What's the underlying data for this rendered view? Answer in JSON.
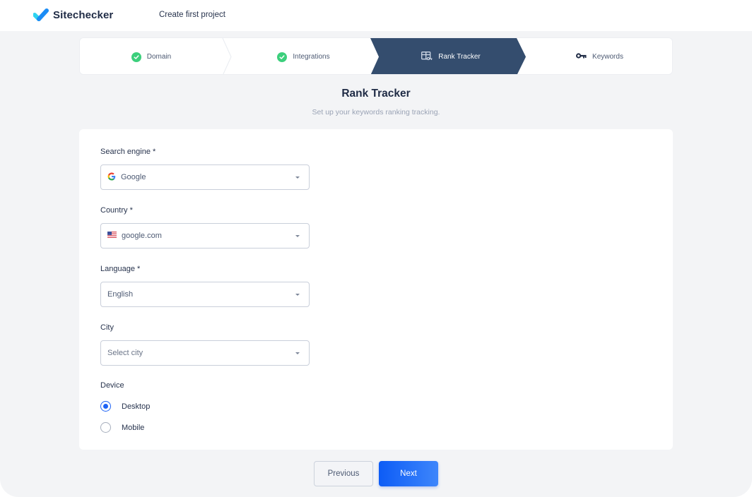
{
  "header": {
    "brand": "Sitechecker",
    "page_heading": "Create first project"
  },
  "stepper": {
    "steps": [
      {
        "label": "Domain",
        "state": "completed",
        "icon": "check-circle-icon"
      },
      {
        "label": "Integrations",
        "state": "completed",
        "icon": "check-circle-icon"
      },
      {
        "label": "Rank Tracker",
        "state": "active",
        "icon": "rank-tracker-icon"
      },
      {
        "label": "Keywords",
        "state": "pending",
        "icon": "key-icon"
      }
    ]
  },
  "main": {
    "title": "Rank Tracker",
    "subtitle": "Set up your keywords ranking tracking."
  },
  "form": {
    "search_engine": {
      "label": "Search engine *",
      "value": "Google",
      "icon": "google-icon"
    },
    "country": {
      "label": "Country *",
      "value": "google.com",
      "icon": "us-flag-icon"
    },
    "language": {
      "label": "Language *",
      "value": "English"
    },
    "city": {
      "label": "City",
      "placeholder": "Select city"
    },
    "device": {
      "label": "Device",
      "options": [
        {
          "label": "Desktop",
          "checked": true
        },
        {
          "label": "Mobile",
          "checked": false
        }
      ]
    }
  },
  "actions": {
    "previous_label": "Previous",
    "next_label": "Next"
  },
  "colors": {
    "accent": "#1e63f5",
    "active_step": "#344d6e",
    "success": "#3ccf7c"
  }
}
